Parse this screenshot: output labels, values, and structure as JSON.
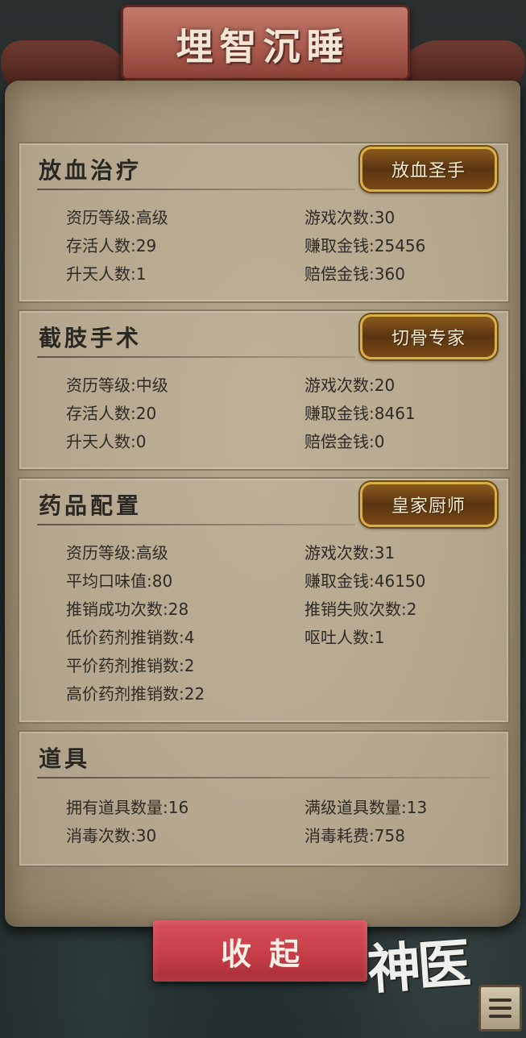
{
  "header": {
    "title": "埋智沉睡"
  },
  "sections": [
    {
      "title": "放血治疗",
      "badge": "放血圣手",
      "stats": [
        {
          "label": "资历等级",
          "value": "高级"
        },
        {
          "label": "游戏次数",
          "value": "30"
        },
        {
          "label": "存活人数",
          "value": "29"
        },
        {
          "label": "赚取金钱",
          "value": "25456"
        },
        {
          "label": "升天人数",
          "value": "1"
        },
        {
          "label": "赔偿金钱",
          "value": "360"
        }
      ]
    },
    {
      "title": "截肢手术",
      "badge": "切骨专家",
      "stats": [
        {
          "label": "资历等级",
          "value": "中级"
        },
        {
          "label": "游戏次数",
          "value": "20"
        },
        {
          "label": "存活人数",
          "value": "20"
        },
        {
          "label": "赚取金钱",
          "value": "8461"
        },
        {
          "label": "升天人数",
          "value": "0"
        },
        {
          "label": "赔偿金钱",
          "value": "0"
        }
      ]
    },
    {
      "title": "药品配置",
      "badge": "皇家厨师",
      "stats": [
        {
          "label": "资历等级",
          "value": "高级"
        },
        {
          "label": "游戏次数",
          "value": "31"
        },
        {
          "label": "平均口味值",
          "value": "80"
        },
        {
          "label": "赚取金钱",
          "value": "46150"
        },
        {
          "label": "推销成功次数",
          "value": "28"
        },
        {
          "label": "推销失败次数",
          "value": "2"
        },
        {
          "label": "低价药剂推销数",
          "value": "4"
        },
        {
          "label": "呕吐人数",
          "value": "1"
        },
        {
          "label": "平价药剂推销数",
          "value": "2"
        },
        {
          "label": "高价药剂推销数",
          "value": "22"
        }
      ]
    },
    {
      "title": "道具",
      "stats": [
        {
          "label": "拥有道具数量",
          "value": "16"
        },
        {
          "label": "满级道具数量",
          "value": "13"
        },
        {
          "label": "消毒次数",
          "value": "30"
        },
        {
          "label": "消毒耗费",
          "value": "758"
        }
      ]
    }
  ],
  "footer": {
    "collapse_label": "收起",
    "logo_text": "神医",
    "menu_icon": "menu-icon"
  }
}
